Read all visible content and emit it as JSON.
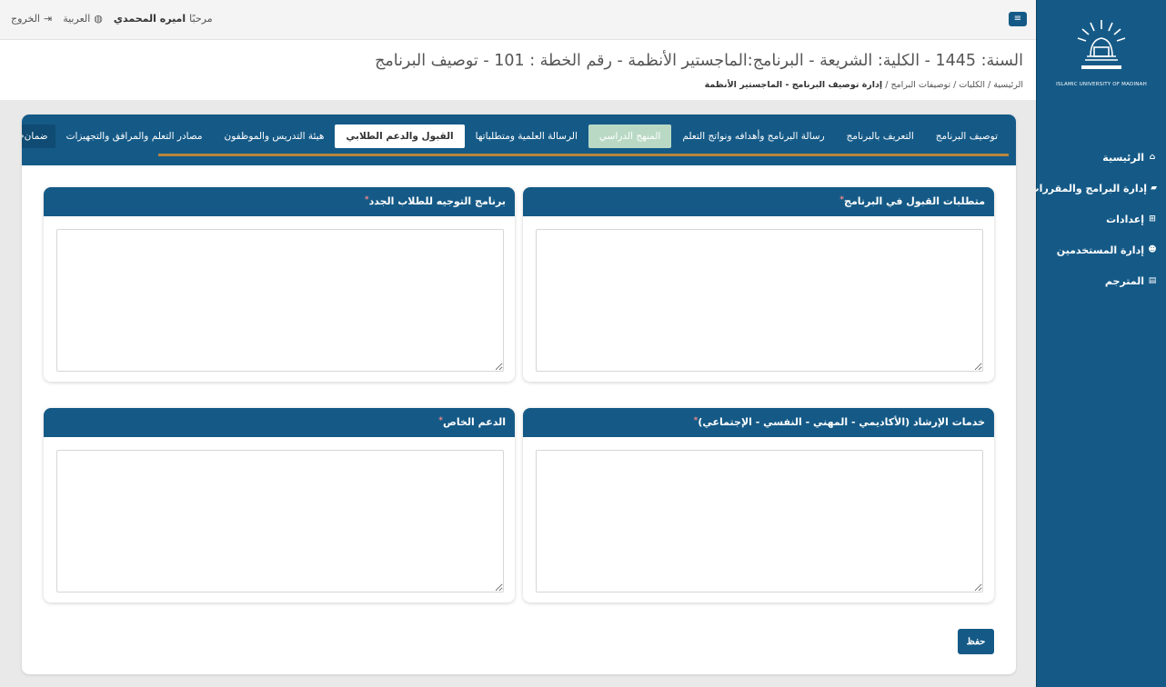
{
  "topbar": {
    "greeting": "مرحبًا",
    "user_name": "اميره المحمدي",
    "language": "العربية",
    "logout": "الخروج"
  },
  "sidebar": {
    "logo_caption": "ISLAMIC UNIVERSITY OF MADINAH",
    "items": [
      {
        "label": "الرئيسية",
        "icon": "home-icon"
      },
      {
        "label": "إدارة البرامج والمقررات",
        "icon": "book-icon"
      },
      {
        "label": "إعدادات",
        "icon": "grid-icon"
      },
      {
        "label": "إدارة المستخدمين",
        "icon": "users-icon"
      },
      {
        "label": "المترجم",
        "icon": "translate-icon"
      }
    ]
  },
  "header": {
    "title": "السنة: 1445 - الكلية: الشريعة - البرنامج:الماجستير الأنظمة - رقم الخطة : 101 - توصيف البرنامج",
    "breadcrumb": [
      "الرئيسية",
      "الكليات",
      "توصيفات البرامج"
    ],
    "breadcrumb_current": "إدارة توصيف البرنامج - الماجستير الأنظمة"
  },
  "tabs": [
    {
      "label": "توصيف البرنامج",
      "state": "normal"
    },
    {
      "label": "التعريف بالبرنامج",
      "state": "normal"
    },
    {
      "label": "رسالة البرنامج وأهدافه ونواتج التعلم",
      "state": "normal"
    },
    {
      "label": "المنهج الدراسي",
      "state": "disabled"
    },
    {
      "label": "الرسالة العلمية ومتطلباتها",
      "state": "normal"
    },
    {
      "label": "القبول والدعم الطلابي",
      "state": "active"
    },
    {
      "label": "هيئة التدريس والموظفون",
      "state": "normal"
    },
    {
      "label": "مصادر التعلم والمرافق والتجهيزات",
      "state": "normal"
    },
    {
      "label": "ضمان",
      "state": "more"
    }
  ],
  "panels": {
    "admission": {
      "title": "متطلبات القبول في البرنامج",
      "value": ""
    },
    "orientation": {
      "title": "برنامج التوجيه للطلاب الجدد",
      "value": ""
    },
    "counseling": {
      "title": "خدمات الإرشاد (الأكاديمي - المهني - النفسي - الإجتماعي)",
      "value": ""
    },
    "special_support": {
      "title": "الدعم الخاص",
      "value": ""
    }
  },
  "save_label": "حفظ",
  "colors": {
    "primary": "#155a87",
    "accent": "#b8863b",
    "disabled_tab": "#b9d9c4"
  }
}
